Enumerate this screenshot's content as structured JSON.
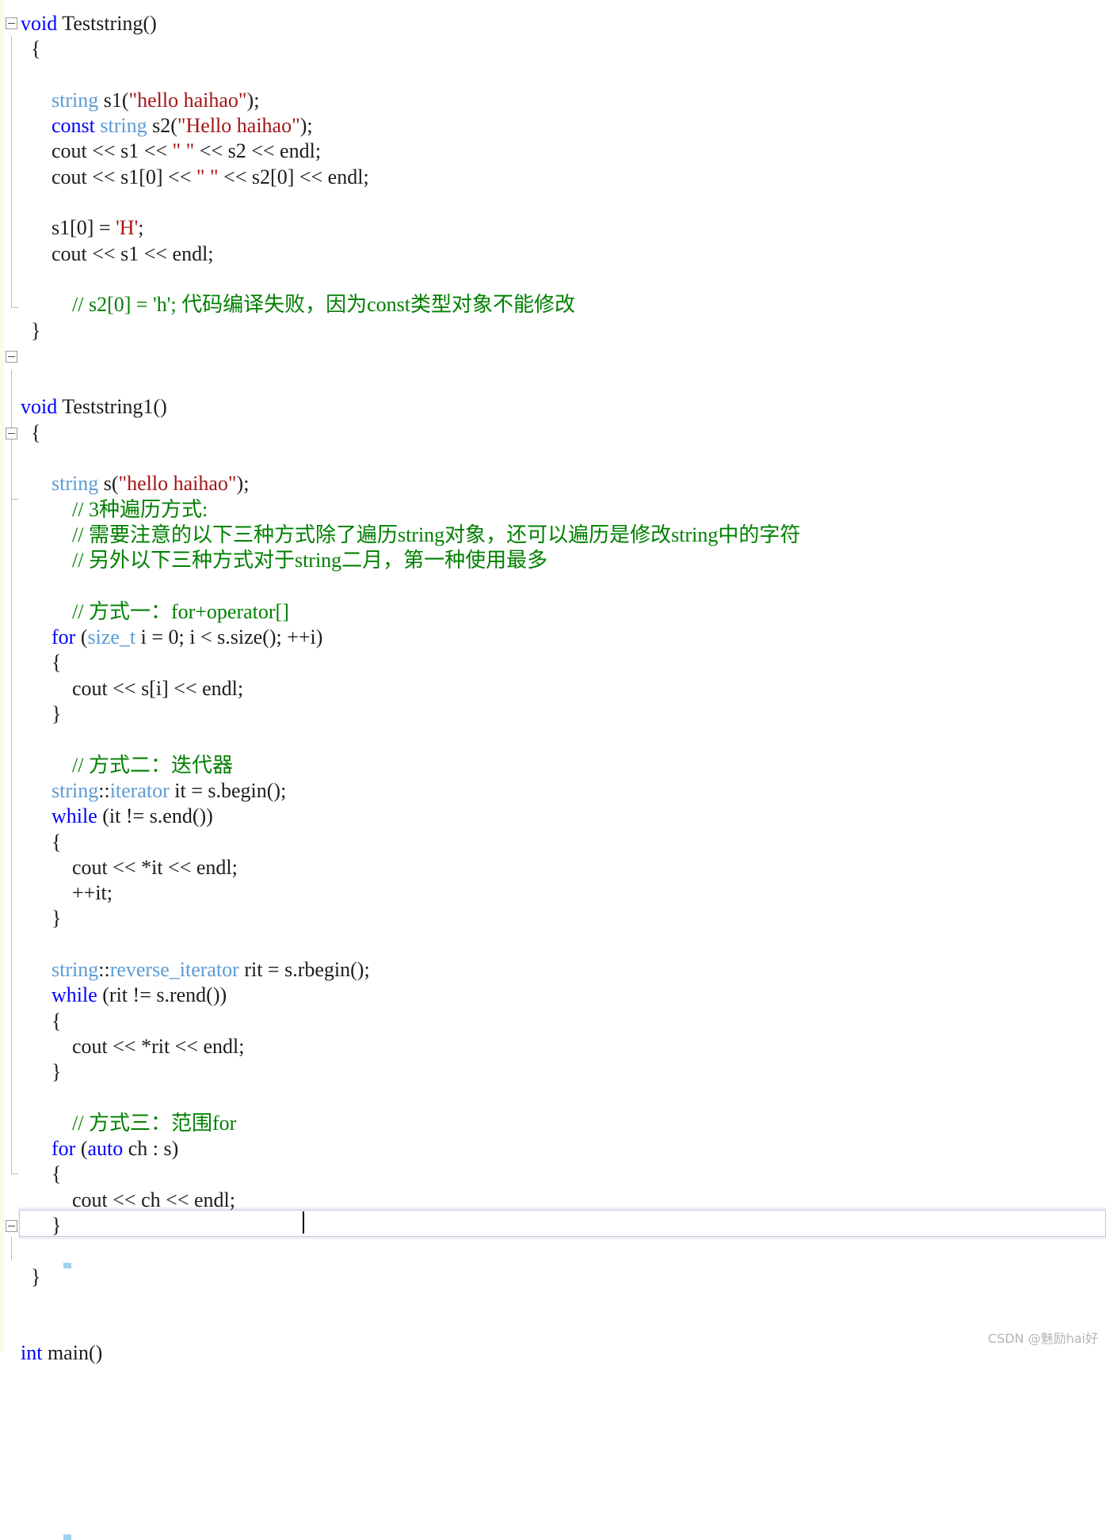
{
  "app": {
    "kind": "code-editor",
    "language": "C++",
    "background": "#ffffff"
  },
  "colors": {
    "keyword": "#0000ff",
    "type": "#5b9bd5",
    "string": "#a31515",
    "comment": "#008000",
    "plain": "#1c1c1c",
    "current_line_border": "#c6cbe0",
    "guide": "#b9b9b9",
    "margin_strip": "#fdfbe3",
    "watermark": "#b4b4b4"
  },
  "watermark": {
    "text": "CSDN @魅励hai好"
  },
  "editor": {
    "caret_visible": true,
    "current_line_index": 45,
    "lines": [
      {
        "i": 0,
        "text": "void Teststring()",
        "outline": true
      },
      {
        "i": 1,
        "text": "{"
      },
      {
        "i": 2,
        "text": ""
      },
      {
        "i": 3,
        "text": "    string s1(\"hello haihao\");"
      },
      {
        "i": 4,
        "text": "    const string s2(\"Hello haihao\");"
      },
      {
        "i": 5,
        "text": "    cout << s1 << \" \" << s2 << endl;"
      },
      {
        "i": 6,
        "text": "    cout << s1[0] << \" \" << s2[0] << endl;"
      },
      {
        "i": 7,
        "text": ""
      },
      {
        "i": 8,
        "text": "    s1[0] = 'H';"
      },
      {
        "i": 9,
        "text": "    cout << s1 << endl;"
      },
      {
        "i": 10,
        "text": ""
      },
      {
        "i": 11,
        "text": "    // s2[0] = 'h'; 代码编译失败，因为const类型对象不能修改"
      },
      {
        "i": 12,
        "text": "}"
      },
      {
        "i": 13,
        "text": ""
      },
      {
        "i": 14,
        "text": ""
      },
      {
        "i": 15,
        "text": "void Teststring1()",
        "outline": true
      },
      {
        "i": 16,
        "text": "{"
      },
      {
        "i": 17,
        "text": ""
      },
      {
        "i": 18,
        "text": "    string s(\"hello haihao\");"
      },
      {
        "i": 19,
        "text": "    // 3种遍历方式:",
        "outline": true
      },
      {
        "i": 20,
        "text": "    // 需要注意的以下三种方式除了遍历string对象，还可以遍历是修改string中的字符"
      },
      {
        "i": 21,
        "text": "    // 另外以下三种方式对于string二月，第一种使用最多"
      },
      {
        "i": 22,
        "text": ""
      },
      {
        "i": 23,
        "text": "    // 方式一：for+operator[]"
      },
      {
        "i": 24,
        "text": "    for (size_t i = 0; i < s.size(); ++i)"
      },
      {
        "i": 25,
        "text": "    {"
      },
      {
        "i": 26,
        "text": "        cout << s[i] << endl;"
      },
      {
        "i": 27,
        "text": "    }"
      },
      {
        "i": 28,
        "text": ""
      },
      {
        "i": 29,
        "text": "    // 方式二：迭代器"
      },
      {
        "i": 30,
        "text": "    string::iterator it = s.begin();"
      },
      {
        "i": 31,
        "text": "    while (it != s.end())"
      },
      {
        "i": 32,
        "text": "    {"
      },
      {
        "i": 33,
        "text": "        cout << *it << endl;"
      },
      {
        "i": 34,
        "text": "        ++it;"
      },
      {
        "i": 35,
        "text": "    }"
      },
      {
        "i": 36,
        "text": ""
      },
      {
        "i": 37,
        "text": "    string::reverse_iterator rit = s.rbegin();"
      },
      {
        "i": 38,
        "text": "    while (rit != s.rend())"
      },
      {
        "i": 39,
        "text": "    {"
      },
      {
        "i": 40,
        "text": "        cout << *rit << endl;"
      },
      {
        "i": 41,
        "text": "    }"
      },
      {
        "i": 42,
        "text": ""
      },
      {
        "i": 43,
        "text": "    // 方式三：范围for"
      },
      {
        "i": 44,
        "text": "    for (auto ch : s)"
      },
      {
        "i": 45,
        "text": "    {"
      },
      {
        "i": 46,
        "text": "        cout << ch << endl;"
      },
      {
        "i": 47,
        "text": "    }"
      },
      {
        "i": 48,
        "text": ""
      },
      {
        "i": 49,
        "text": "}"
      },
      {
        "i": 50,
        "text": ""
      },
      {
        "i": 51,
        "text": ""
      },
      {
        "i": 52,
        "text": "int main()",
        "outline": true
      }
    ]
  },
  "tokens": {
    "keywords": [
      "void",
      "const",
      "for",
      "while",
      "auto",
      "int"
    ],
    "types": [
      "string",
      "size_t",
      "iterator",
      "reverse_iterator"
    ],
    "strings": [
      "\"hello haihao\"",
      "\"Hello haihao\"",
      "\" \"",
      "'H'",
      "'h'"
    ],
    "comments": [
      "// s2[0] = 'h'; 代码编译失败，因为const类型对象不能修改",
      "// 3种遍历方式:",
      "// 需要注意的以下三种方式除了遍历string对象，还可以遍历是修改string中的字符",
      "// 另外以下三种方式对于string二月，第一种使用最多",
      "// 方式一：for+operator[]",
      "// 方式二：迭代器",
      "// 方式三：范围for"
    ]
  }
}
